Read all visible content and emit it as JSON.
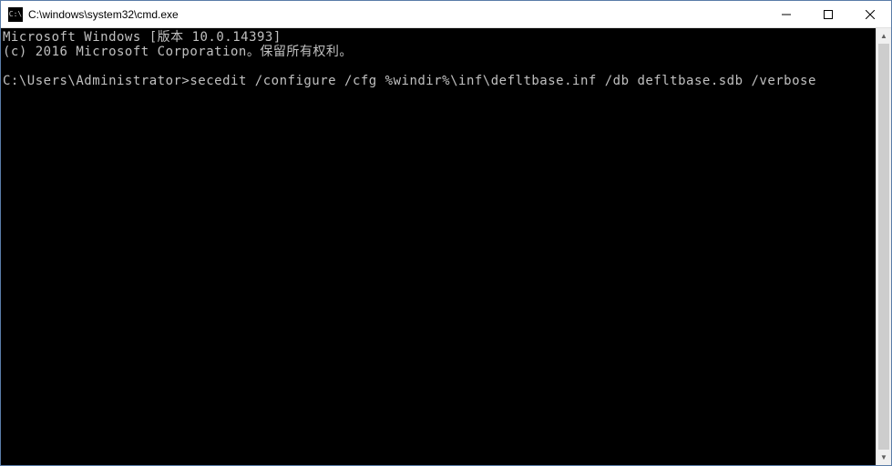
{
  "titlebar": {
    "icon_text": "C:\\",
    "title": "C:\\windows\\system32\\cmd.exe"
  },
  "terminal": {
    "line1": "Microsoft Windows [版本 10.0.14393]",
    "line2": "(c) 2016 Microsoft Corporation。保留所有权利。",
    "blank": "",
    "prompt": "C:\\Users\\Administrator>",
    "command": "secedit /configure /cfg %windir%\\inf\\defltbase.inf /db defltbase.sdb /verbose"
  }
}
